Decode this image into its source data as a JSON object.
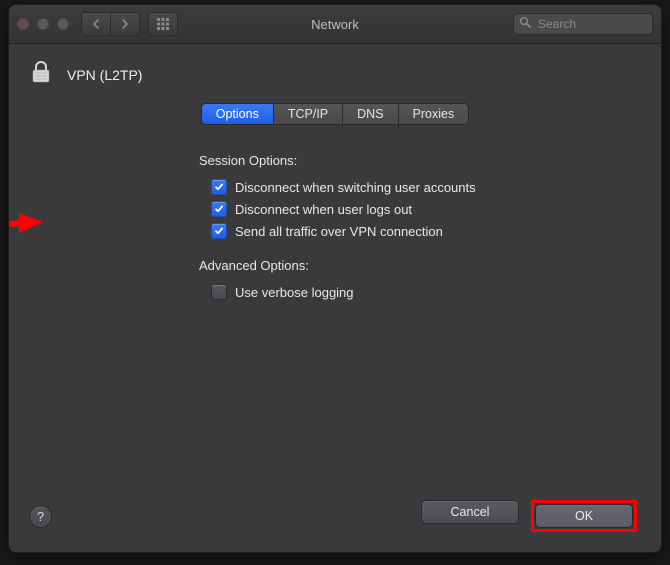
{
  "window": {
    "title": "Network",
    "search_placeholder": "Search"
  },
  "pane": {
    "title": "VPN (L2TP)"
  },
  "tabs": [
    {
      "id": "options",
      "label": "Options",
      "active": true
    },
    {
      "id": "tcpip",
      "label": "TCP/IP",
      "active": false
    },
    {
      "id": "dns",
      "label": "DNS",
      "active": false
    },
    {
      "id": "proxies",
      "label": "Proxies",
      "active": false
    }
  ],
  "sections": {
    "session": {
      "heading": "Session Options:",
      "items": [
        {
          "id": "disconnect_switch_user",
          "label": "Disconnect when switching user accounts",
          "checked": true
        },
        {
          "id": "disconnect_logout",
          "label": "Disconnect when user logs out",
          "checked": true
        },
        {
          "id": "send_all_traffic",
          "label": "Send all traffic over VPN connection",
          "checked": true,
          "highlighted": true
        }
      ]
    },
    "advanced": {
      "heading": "Advanced Options:",
      "items": [
        {
          "id": "verbose_logging",
          "label": "Use verbose logging",
          "checked": false
        }
      ]
    }
  },
  "footer": {
    "help_label": "?",
    "cancel_label": "Cancel",
    "ok_label": "OK"
  },
  "icon_names": {
    "lock": "lock-icon",
    "search": "search-icon",
    "apps_grid": "apps-grid-icon",
    "chevron_left": "chevron-left-icon",
    "chevron_right": "chevron-right-icon"
  },
  "annotations": {
    "arrow_target": "send_all_traffic",
    "ok_highlighted": true,
    "colors": {
      "accent": "#1f5fe6",
      "highlight": "#ff0000"
    }
  }
}
